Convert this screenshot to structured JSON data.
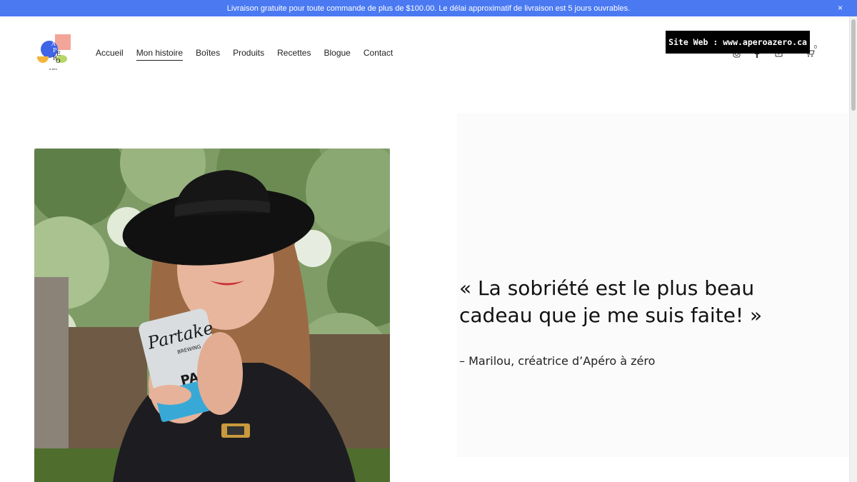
{
  "announcement": {
    "text": "Livraison gratuite pour toute commande de plus de $100.00. Le délai approximatif de livraison est 5 jours ouvrables.",
    "close": "×",
    "bg_color": "#4a79f2"
  },
  "logo": {
    "letters": [
      "A",
      "P",
      "É",
      "R",
      "O"
    ],
    "subtitle": "à zéro"
  },
  "nav": {
    "items": [
      {
        "label": "Accueil"
      },
      {
        "label": "Mon histoire",
        "active": true
      },
      {
        "label": "Boîtes"
      },
      {
        "label": "Produits"
      },
      {
        "label": "Recettes"
      },
      {
        "label": "Blogue"
      },
      {
        "label": "Contact"
      }
    ]
  },
  "overlay": {
    "site_label": "Site Web : www.aperoazero.ca"
  },
  "header_icons": [
    "instagram-icon",
    "facebook-icon",
    "youtube-icon",
    "cart-icon"
  ],
  "cart": {
    "count": "0"
  },
  "hero": {
    "quote": "« La sobriété est le plus beau cadeau que je me suis faite! »",
    "attribution": "– Marilou, créatrice d’Apéro à zéro"
  },
  "photo_can": {
    "brand": "Partake",
    "sub": "BREWING",
    "style": "PALE"
  }
}
